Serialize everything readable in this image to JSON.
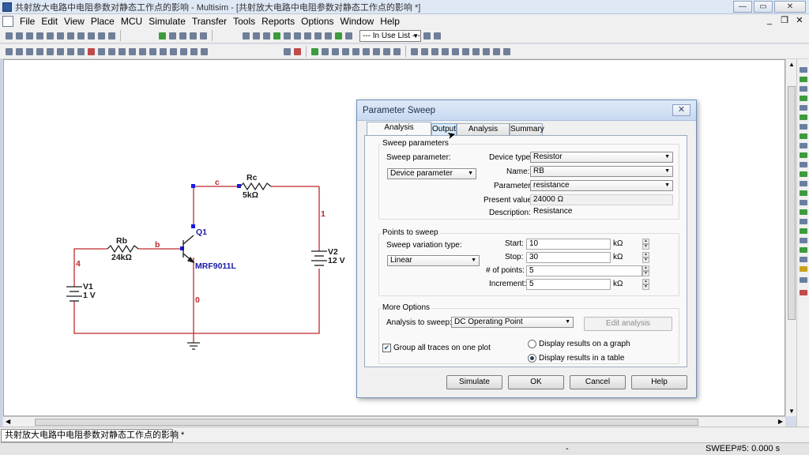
{
  "window": {
    "title": "共射放大电路中电阻参数对静态工作点的影响 - Multisim - [共射放大电路中电阻参数对静态工作点的影响 *]",
    "minimize": "—",
    "restore": "▭",
    "close": "✕"
  },
  "menu": {
    "items": [
      "File",
      "Edit",
      "View",
      "Place",
      "MCU",
      "Simulate",
      "Transfer",
      "Tools",
      "Reports",
      "Options",
      "Window",
      "Help"
    ],
    "mdi_minimize": "_",
    "mdi_restore": "❐",
    "mdi_close": "✕"
  },
  "toolbar": {
    "in_use_list": "--- In Use List ---"
  },
  "schematic": {
    "components": {
      "rc_name": "Rc",
      "rc_value": "5kΩ",
      "rb_name": "Rb",
      "rb_value": "24kΩ",
      "q1_name": "Q1",
      "q1_model": "MRF9011L",
      "v1_name": "V1",
      "v1_value": "1 V",
      "v2_name": "V2",
      "v2_value": "12 V"
    },
    "nets": {
      "c": "c",
      "b": "b",
      "n1": "1",
      "n4": "4",
      "n0": "0"
    },
    "colors": {
      "wire": "#c0282d",
      "component": "#1a1aa6",
      "node": "#1a1ae0"
    }
  },
  "dialog": {
    "title": "Parameter Sweep",
    "close": "✕",
    "tabs": [
      "Analysis parameters",
      "Output",
      "Analysis options",
      "Summary"
    ],
    "sweep_parameters": {
      "group_label": "Sweep parameters",
      "sweep_parameter_label": "Sweep parameter:",
      "sweep_parameter_value": "Device parameter",
      "device_type_label": "Device type:",
      "device_type_value": "Resistor",
      "name_label": "Name:",
      "name_value": "RB",
      "parameter_label": "Parameter:",
      "parameter_value": "resistance",
      "present_value_label": "Present value:",
      "present_value": "24000 Ω",
      "description_label": "Description:",
      "description_value": "Resistance"
    },
    "points_to_sweep": {
      "group_label": "Points to sweep",
      "variation_type_label": "Sweep variation type:",
      "variation_type_value": "Linear",
      "start_label": "Start:",
      "start_value": "10",
      "start_unit": "kΩ",
      "stop_label": "Stop:",
      "stop_value": "30",
      "stop_unit": "kΩ",
      "points_label": "# of points:",
      "points_value": "5",
      "increment_label": "Increment:",
      "increment_value": "5",
      "increment_unit": "kΩ"
    },
    "more_options": {
      "group_label": "More Options",
      "analysis_to_sweep_label": "Analysis to sweep:",
      "analysis_to_sweep_value": "DC Operating Point",
      "edit_analysis": "Edit analysis",
      "group_traces_label": "Group all traces on one plot",
      "group_traces_checked": true,
      "display_graph_label": "Display results on a graph",
      "display_table_label": "Display results in a table",
      "display_selected": "table"
    },
    "buttons": {
      "simulate": "Simulate",
      "ok": "OK",
      "cancel": "Cancel",
      "help": "Help"
    }
  },
  "sheet_tabs": {
    "active": "共射放大电路中电阻参数对静态工作点的影响 *"
  },
  "status": {
    "dash": "-",
    "sweep": "SWEEP#5: 0.000 s"
  }
}
